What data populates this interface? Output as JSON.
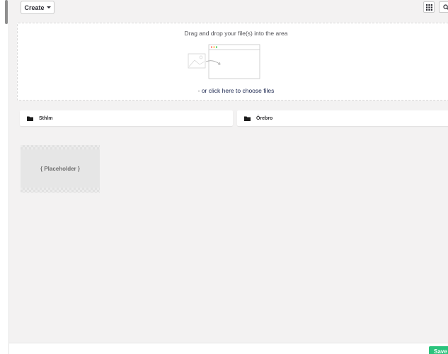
{
  "toolbar": {
    "create_label": "Create",
    "grid_icon": "grid-icon",
    "search_icon": "search-icon"
  },
  "dropzone": {
    "title": "Drag and drop your file(s) into the area",
    "link_prefix": "- ",
    "link_text": "or click here to choose files"
  },
  "folders": [
    {
      "name": "Sthlm",
      "icon": "folder-icon"
    },
    {
      "name": "Örebro",
      "icon": "folder-icon"
    }
  ],
  "tile": {
    "label": "{ Placeholder }"
  },
  "footer": {
    "save_label": "Save"
  },
  "colors": {
    "accent_green": "#2bc37c",
    "link_navy": "#1b264f",
    "background": "#f3f2f2"
  }
}
